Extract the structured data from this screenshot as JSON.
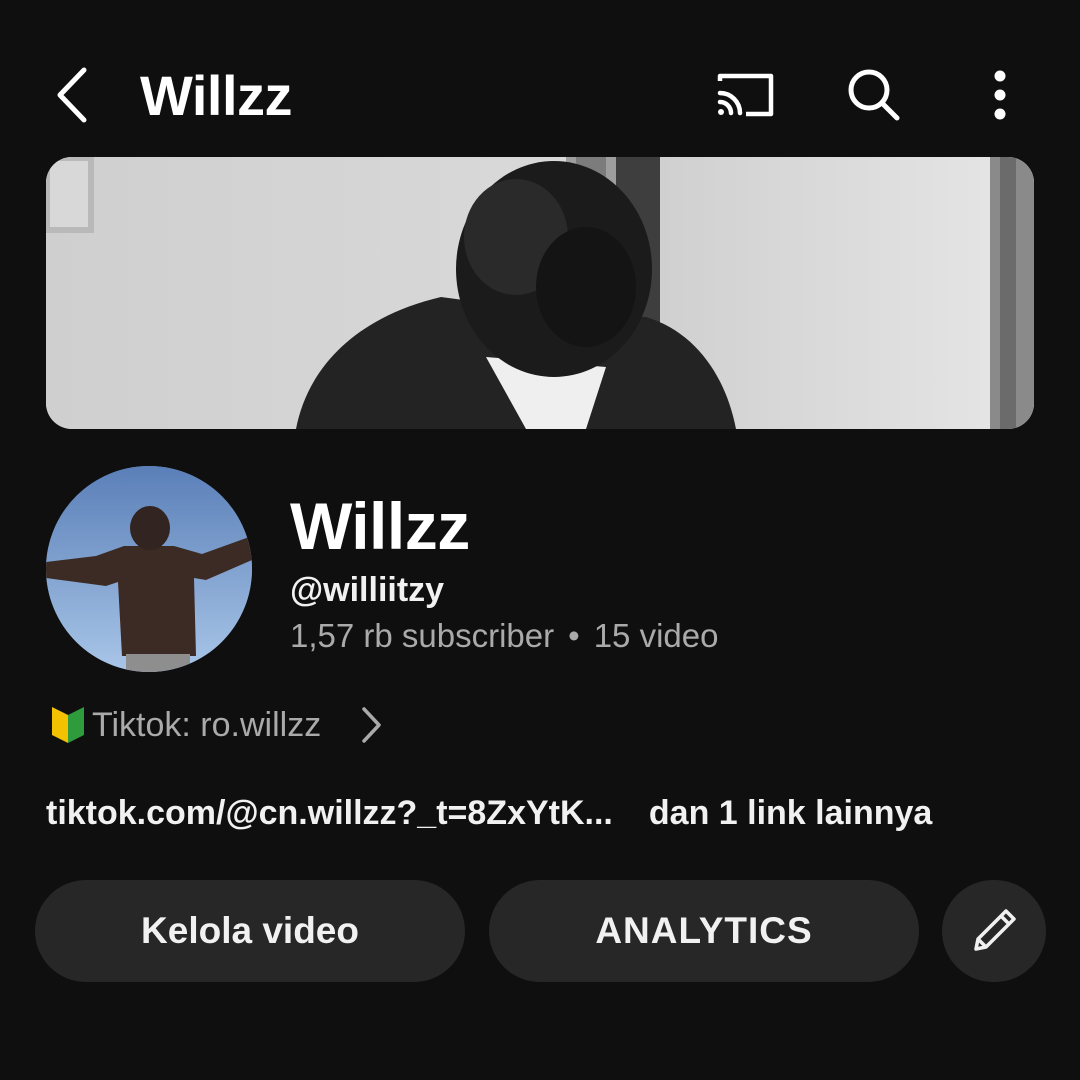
{
  "header": {
    "title": "Willzz",
    "icons": [
      "back-arrow-icon",
      "cast-icon",
      "search-icon",
      "more-vertical-icon"
    ]
  },
  "channel": {
    "name": "Willzz",
    "handle": "@williitzy",
    "subscribers": "1,57 rb subscriber",
    "separator": "•",
    "videos": "15 video"
  },
  "description": {
    "icon": "beginner-mark-icon",
    "text": "Tiktok: ro.willzz"
  },
  "links": {
    "primary": "tiktok.com/@cn.willzz?_t=8ZxYtK...",
    "more": "dan 1 link lainnya"
  },
  "actions": {
    "manage_label": "Kelola video",
    "analytics_label": "ANALYTICS",
    "edit_icon": "pencil-icon"
  },
  "colors": {
    "background": "#0f0f0f",
    "button": "#272727",
    "secondary_text": "#aaaaaa"
  }
}
